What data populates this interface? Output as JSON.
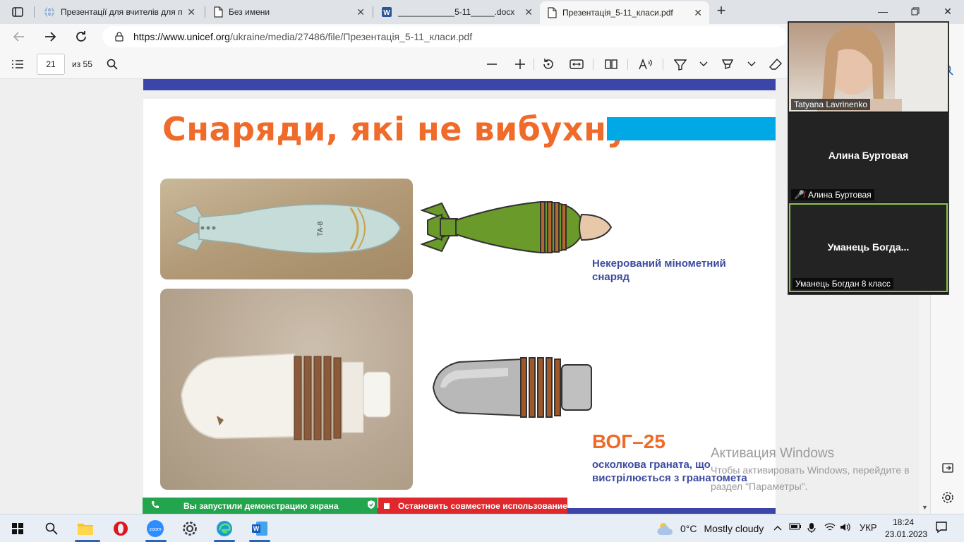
{
  "browser": {
    "tabs": [
      {
        "title": "Презентації для вчителів для пр",
        "icon": "globe-icon"
      },
      {
        "title": "Без имени",
        "icon": "document-icon"
      },
      {
        "title": "____________5-11_____.docx",
        "icon": "word-icon"
      },
      {
        "title": "Презентація_5-11_класи.pdf",
        "icon": "document-icon",
        "active": true
      }
    ],
    "url_host": "https://www.unicef.org",
    "url_path": "/ukraine/media/27486/file/Презентація_5-11_класи.pdf"
  },
  "pdf_toolbar": {
    "page_number": "21",
    "page_count": "из 55"
  },
  "slide": {
    "title": "Снаряди, які не вибухнули",
    "item1_caption": "Некерований мінометний снаряд",
    "item2_name": "ВОГ–25",
    "item2_caption": "осколкова граната, що вистрілюється з гранатомета",
    "colors": {
      "title": "#f06a2a",
      "caption": "#3b4ba0",
      "accent_bar": "#00a9e6",
      "strip": "#3c46a8"
    }
  },
  "zoom": {
    "tiles": [
      {
        "label": "Tatyana Lavrinenko",
        "center_name": "",
        "muted": false
      },
      {
        "label": "Алина Буртовая",
        "center_name": "Алина Буртовая",
        "muted": true
      },
      {
        "label": "Уманець Богдан 8 класс",
        "center_name": "Уманець  Богда...",
        "muted": false
      }
    ]
  },
  "watermark": {
    "title": "Активация Windows",
    "line1": "Чтобы активировать Windows, перейдите в",
    "line2": "раздел \"Параметры\"."
  },
  "share": {
    "status": "Вы запустили демонстрацию экрана",
    "stop": "Остановить совместное использование"
  },
  "taskbar": {
    "temperature": "0°C",
    "weather": "Mostly cloudy",
    "language": "УКР",
    "time": "18:24",
    "date": "23.01.2023"
  }
}
